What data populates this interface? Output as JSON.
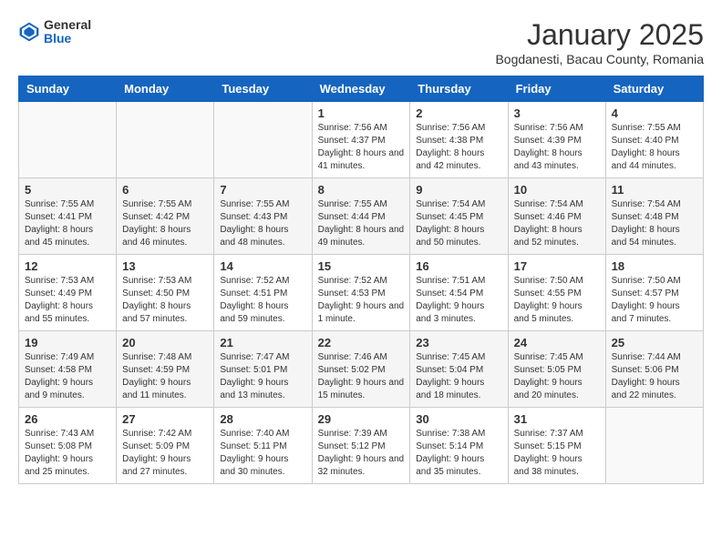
{
  "header": {
    "logo_general": "General",
    "logo_blue": "Blue",
    "month_title": "January 2025",
    "subtitle": "Bogdanesti, Bacau County, Romania"
  },
  "weekdays": [
    "Sunday",
    "Monday",
    "Tuesday",
    "Wednesday",
    "Thursday",
    "Friday",
    "Saturday"
  ],
  "weeks": [
    [
      {
        "day": "",
        "info": ""
      },
      {
        "day": "",
        "info": ""
      },
      {
        "day": "",
        "info": ""
      },
      {
        "day": "1",
        "info": "Sunrise: 7:56 AM\nSunset: 4:37 PM\nDaylight: 8 hours and 41 minutes."
      },
      {
        "day": "2",
        "info": "Sunrise: 7:56 AM\nSunset: 4:38 PM\nDaylight: 8 hours and 42 minutes."
      },
      {
        "day": "3",
        "info": "Sunrise: 7:56 AM\nSunset: 4:39 PM\nDaylight: 8 hours and 43 minutes."
      },
      {
        "day": "4",
        "info": "Sunrise: 7:55 AM\nSunset: 4:40 PM\nDaylight: 8 hours and 44 minutes."
      }
    ],
    [
      {
        "day": "5",
        "info": "Sunrise: 7:55 AM\nSunset: 4:41 PM\nDaylight: 8 hours and 45 minutes."
      },
      {
        "day": "6",
        "info": "Sunrise: 7:55 AM\nSunset: 4:42 PM\nDaylight: 8 hours and 46 minutes."
      },
      {
        "day": "7",
        "info": "Sunrise: 7:55 AM\nSunset: 4:43 PM\nDaylight: 8 hours and 48 minutes."
      },
      {
        "day": "8",
        "info": "Sunrise: 7:55 AM\nSunset: 4:44 PM\nDaylight: 8 hours and 49 minutes."
      },
      {
        "day": "9",
        "info": "Sunrise: 7:54 AM\nSunset: 4:45 PM\nDaylight: 8 hours and 50 minutes."
      },
      {
        "day": "10",
        "info": "Sunrise: 7:54 AM\nSunset: 4:46 PM\nDaylight: 8 hours and 52 minutes."
      },
      {
        "day": "11",
        "info": "Sunrise: 7:54 AM\nSunset: 4:48 PM\nDaylight: 8 hours and 54 minutes."
      }
    ],
    [
      {
        "day": "12",
        "info": "Sunrise: 7:53 AM\nSunset: 4:49 PM\nDaylight: 8 hours and 55 minutes."
      },
      {
        "day": "13",
        "info": "Sunrise: 7:53 AM\nSunset: 4:50 PM\nDaylight: 8 hours and 57 minutes."
      },
      {
        "day": "14",
        "info": "Sunrise: 7:52 AM\nSunset: 4:51 PM\nDaylight: 8 hours and 59 minutes."
      },
      {
        "day": "15",
        "info": "Sunrise: 7:52 AM\nSunset: 4:53 PM\nDaylight: 9 hours and 1 minute."
      },
      {
        "day": "16",
        "info": "Sunrise: 7:51 AM\nSunset: 4:54 PM\nDaylight: 9 hours and 3 minutes."
      },
      {
        "day": "17",
        "info": "Sunrise: 7:50 AM\nSunset: 4:55 PM\nDaylight: 9 hours and 5 minutes."
      },
      {
        "day": "18",
        "info": "Sunrise: 7:50 AM\nSunset: 4:57 PM\nDaylight: 9 hours and 7 minutes."
      }
    ],
    [
      {
        "day": "19",
        "info": "Sunrise: 7:49 AM\nSunset: 4:58 PM\nDaylight: 9 hours and 9 minutes."
      },
      {
        "day": "20",
        "info": "Sunrise: 7:48 AM\nSunset: 4:59 PM\nDaylight: 9 hours and 11 minutes."
      },
      {
        "day": "21",
        "info": "Sunrise: 7:47 AM\nSunset: 5:01 PM\nDaylight: 9 hours and 13 minutes."
      },
      {
        "day": "22",
        "info": "Sunrise: 7:46 AM\nSunset: 5:02 PM\nDaylight: 9 hours and 15 minutes."
      },
      {
        "day": "23",
        "info": "Sunrise: 7:45 AM\nSunset: 5:04 PM\nDaylight: 9 hours and 18 minutes."
      },
      {
        "day": "24",
        "info": "Sunrise: 7:45 AM\nSunset: 5:05 PM\nDaylight: 9 hours and 20 minutes."
      },
      {
        "day": "25",
        "info": "Sunrise: 7:44 AM\nSunset: 5:06 PM\nDaylight: 9 hours and 22 minutes."
      }
    ],
    [
      {
        "day": "26",
        "info": "Sunrise: 7:43 AM\nSunset: 5:08 PM\nDaylight: 9 hours and 25 minutes."
      },
      {
        "day": "27",
        "info": "Sunrise: 7:42 AM\nSunset: 5:09 PM\nDaylight: 9 hours and 27 minutes."
      },
      {
        "day": "28",
        "info": "Sunrise: 7:40 AM\nSunset: 5:11 PM\nDaylight: 9 hours and 30 minutes."
      },
      {
        "day": "29",
        "info": "Sunrise: 7:39 AM\nSunset: 5:12 PM\nDaylight: 9 hours and 32 minutes."
      },
      {
        "day": "30",
        "info": "Sunrise: 7:38 AM\nSunset: 5:14 PM\nDaylight: 9 hours and 35 minutes."
      },
      {
        "day": "31",
        "info": "Sunrise: 7:37 AM\nSunset: 5:15 PM\nDaylight: 9 hours and 38 minutes."
      },
      {
        "day": "",
        "info": ""
      }
    ]
  ]
}
